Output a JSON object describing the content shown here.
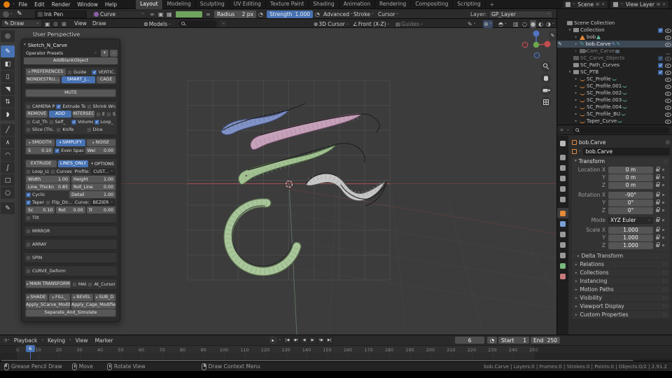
{
  "topbar": {
    "menus": [
      "File",
      "Edit",
      "Render",
      "Window",
      "Help"
    ],
    "workspaces": [
      "Layout",
      "Modeling",
      "Sculpting",
      "UV Editing",
      "Texture Paint",
      "Shading",
      "Animation",
      "Rendering",
      "Compositing",
      "Scripting"
    ],
    "active_workspace": "Layout",
    "add_workspace_label": "+",
    "scene_name": "Scene",
    "view_layer_name": "View Layer"
  },
  "tool_settings": {
    "brush_name": "Ink Pen",
    "material_name": "Curve",
    "material_color": "#8d5fa8",
    "vertex_color": "#6fa35e",
    "radius_label": "Radius",
    "radius_value": "2 px",
    "strength_label": "Strength",
    "strength_value": "1.000",
    "advanced_label": "Advanced",
    "stroke_label": "Stroke",
    "cursor_label": "Cursor",
    "layer_label": "Layer:",
    "layer_value": "GP_Layer"
  },
  "viewport": {
    "mode_label": "Draw",
    "view_menu": "View",
    "draw_menu": "Draw",
    "asset_browser_label": "Models",
    "pivot_label": "3D Cursor",
    "orientation_label": "Front (X-Z)",
    "guides_label": "Guides",
    "overlay_text": "User Perspective"
  },
  "tools": [
    "cursor",
    "draw",
    "fill",
    "erase",
    "cutter",
    "interpolate",
    "tint",
    "line",
    "polyline",
    "arc",
    "curve",
    "box",
    "circle",
    "annotate"
  ],
  "active_tool": "draw",
  "panel": {
    "title": "Sketch_N_Carve",
    "presets_label": "Operator Presets",
    "preset_add": "+",
    "preset_remove": "-",
    "add_blank": "AddBlankObject",
    "preferences": "PREFERENCES",
    "guide": "Guide",
    "vertical": "VERTIC...",
    "nondestructive": "NONDESTRU...",
    "smart_join": "SMART_J...",
    "cage": "CAGE",
    "mute": "MUTE",
    "camera_p": "CAMERA P...",
    "extrude_to": "Extrude To...",
    "shrink_wrap": "Shrink Wrap",
    "remove": "REMOVE",
    "add": "ADD",
    "intersect": "INTERSECT",
    "e": "E",
    "s": "S",
    "cut_th": "Cut_Th...",
    "self": "Self_",
    "volume": "Volume",
    "loop": "Loop_",
    "slice": "Slice (Thi...",
    "knife": "Knife",
    "dice": "Dice",
    "smooth": "SMOOTH",
    "simplify": "SIMPLIFY",
    "noise": "NOISE",
    "s_label": "S",
    "s_value": "0.10",
    "even_spacing": "Even Spac...",
    "wei_label": "Wei",
    "wei_value": "0.00",
    "extrude": "EXTRUDE",
    "lines_only": "LINES_ONLY",
    "options": "OPTIONS",
    "loop_ll": "Loop_LL...",
    "curves": "Curves",
    "profile_label": "Profile:",
    "profile_value": "CUST...",
    "width_label": "Width",
    "width_value": "1.00",
    "height_label": "Height",
    "height_value": "1.00",
    "line_thick_label": "Line_Thickn",
    "line_thick_value": "0.85",
    "roll_line_label": "Roll_Line",
    "roll_line_value": "0.00",
    "cyclic": "Cyclic",
    "detail_label": "Detail",
    "detail_value": "1.00",
    "taper": "Taper",
    "flip_dir": "Flip_Dir...",
    "curve_label": "Curve:",
    "curve_value": "BEZIER",
    "sc_label": "Sc",
    "sc_value": "0.10",
    "rot_label": "Rot",
    "rot_value": "0.00",
    "tr_label": "Tr",
    "tr_value": "0.00",
    "tilt": "Tilt",
    "mirror": "MIRROR",
    "array": "ARRAY",
    "spin": "SPIN",
    "curve_deform": "CURVE_Deform",
    "main_transform": "MAIN TRANSFORM",
    "mai": "MAI",
    "at_cursor": "At_Cursor",
    "shade": "SHADE",
    "fill": "FILL_",
    "bevel": "BEVEL",
    "subd": "SUB_D",
    "apply_scarve": "Apply_SCarve_Modifiers",
    "apply_cage": "Apply_Cage_Modifiers",
    "separate": "Separate_And_Simulate"
  },
  "panel_state": {
    "guide": 0,
    "vertical": 1,
    "camera_p": 0,
    "extrude_to": 1,
    "shrink_wrap": 0,
    "e": 0,
    "s": 0,
    "cut_th": 0,
    "self": 0,
    "volume": 1,
    "loop": 1,
    "slice": 0,
    "knife": 0,
    "dice": 0,
    "even_spacing": 1,
    "loop_ll": 0,
    "curves": 0,
    "cyclic": 1,
    "taper": 1,
    "flip_dir": 0,
    "tilt": 0,
    "mirror": 0,
    "array": 0,
    "spin": 0,
    "curve_deform": 0,
    "mai": 0,
    "at_cursor": 0
  },
  "outliner": {
    "items": [
      {
        "name": "Scene Collection",
        "depth": 0,
        "icon": "collection"
      },
      {
        "name": "Collection",
        "depth": 1,
        "icon": "collection",
        "caret": "open",
        "check": true,
        "eye": "open"
      },
      {
        "name": "bob",
        "depth": 2,
        "icon": "cone",
        "caret": "closed",
        "extras": [
          "mesh-data"
        ],
        "eye": "open"
      },
      {
        "name": "bob.Carve",
        "depth": 2,
        "icon": "gpencil",
        "caret": "closed",
        "extras": [
          "brush-data",
          "gpencil-data"
        ],
        "eye": "open",
        "selected": true,
        "mode_icon": true
      },
      {
        "name": "Cam_Carve",
        "depth": 2,
        "icon": "camera",
        "caret": "closed",
        "extras": [
          "camera-data"
        ],
        "eye": "closed",
        "dim": true
      },
      {
        "name": "SC_Carve_Objects",
        "depth": 1,
        "icon": "collection",
        "check": true,
        "eye": "open",
        "dim": true
      },
      {
        "name": "SC_Path_Curves",
        "depth": 1,
        "icon": "collection",
        "check": true,
        "eye": "open"
      },
      {
        "name": "SC_PTB",
        "depth": 1,
        "icon": "collection",
        "caret": "open",
        "check": true,
        "eye": "open"
      },
      {
        "name": "SC_Profile",
        "depth": 2,
        "icon": "curve",
        "caret": "closed",
        "extras": [
          "curve-data"
        ],
        "eye": "open"
      },
      {
        "name": "SC_Profile.001",
        "depth": 2,
        "icon": "curve",
        "caret": "closed",
        "extras": [
          "curve-data"
        ],
        "eye": "open"
      },
      {
        "name": "SC_Profile.002",
        "depth": 2,
        "icon": "curve",
        "caret": "closed",
        "extras": [
          "curve-data"
        ],
        "eye": "open"
      },
      {
        "name": "SC_Profile.003",
        "depth": 2,
        "icon": "curve",
        "caret": "closed",
        "extras": [
          "curve-data"
        ],
        "eye": "open"
      },
      {
        "name": "SC_Profile.004",
        "depth": 2,
        "icon": "curve",
        "caret": "closed",
        "extras": [
          "curve-data"
        ],
        "eye": "open"
      },
      {
        "name": "SC_Profile_BU",
        "depth": 2,
        "icon": "curve",
        "caret": "closed",
        "extras": [
          "curve-data"
        ],
        "eye": "open"
      },
      {
        "name": "Taper_Curve",
        "depth": 2,
        "icon": "curve",
        "caret": "closed",
        "extras": [
          "curve-data"
        ],
        "eye": "open"
      }
    ]
  },
  "properties": {
    "breadcrumb": "bob.Carve",
    "name_value": "bob.Carve",
    "transform_title": "Transform",
    "transform_rows": [
      {
        "label": "Location X",
        "value": "0 m"
      },
      {
        "label": "Y",
        "value": "0 m"
      },
      {
        "label": "Z",
        "value": "0 m"
      },
      {
        "label": "Rotation X",
        "value": "-90°",
        "mt": true
      },
      {
        "label": "Y",
        "value": "0°"
      },
      {
        "label": "Z",
        "value": "0°"
      },
      {
        "label": "Mode",
        "value": "XYZ Euler",
        "dropdown": true,
        "mt": true
      },
      {
        "label": "Scale X",
        "value": "1.000",
        "mt": true
      },
      {
        "label": "Y",
        "value": "1.000"
      },
      {
        "label": "Z",
        "value": "1.000"
      }
    ],
    "delta_label": "Delta Transform",
    "sections": [
      "Relations",
      "Collections",
      "Instancing",
      "Motion Paths",
      "Visibility",
      "Viewport Display",
      "Custom Properties"
    ],
    "tabs": [
      "tool",
      "render",
      "output",
      "view-layer",
      "scene",
      "world",
      "object",
      "modifiers",
      "particles",
      "physics",
      "constraints",
      "object-data",
      "material"
    ],
    "active_tab": "object"
  },
  "timeline": {
    "menus": [
      "Playback",
      "Keying",
      "View",
      "Marker"
    ],
    "current_frame": "6",
    "playhead_frame": 6,
    "start_label": "Start",
    "start_value": "1",
    "end_label": "End",
    "end_value": "250",
    "tick_step": 10,
    "tick_max": 250
  },
  "status_bar": {
    "hints": [
      {
        "mouse": "lmb",
        "label": "Grease Pencil Draw"
      },
      {
        "mouse": "mmb",
        "label": "Move"
      },
      {
        "mouse": "mmb",
        "label": "Rotate View"
      },
      {
        "mouse": "rmb",
        "label": "Draw Context Menu"
      }
    ],
    "stats": "bob.Carve | Layers:0 | Frames:0 | Strokes:0 | Points:0 | Objects:0/2 | 2.91.2"
  },
  "colors": {
    "accent": "#4772b3",
    "object_orange": "#e58a3a",
    "selection_bg": "#3d4855"
  }
}
